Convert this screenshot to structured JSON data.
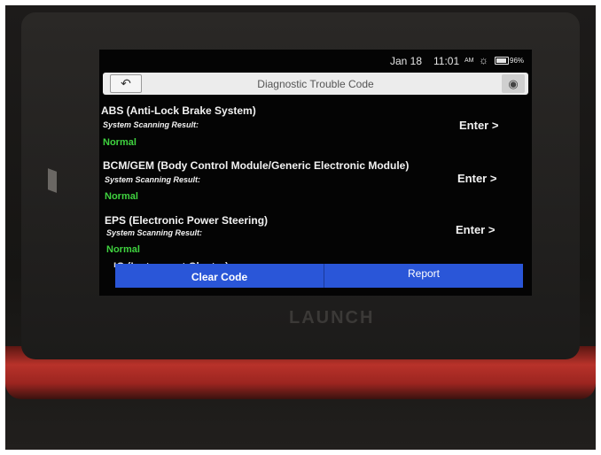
{
  "device": {
    "brand": "LAUNCH"
  },
  "status_bar": {
    "date": "Jan 18",
    "time": "11:01",
    "ampm": "AM",
    "battery": "96%"
  },
  "header": {
    "title": "Diagnostic Trouble Code",
    "back_icon": "back-arrow-icon",
    "camera_icon": "camera-icon"
  },
  "modules": [
    {
      "name": "ABS (Anti-Lock Brake System)",
      "result_label": "System Scanning Result:",
      "status": "Normal",
      "enter_label": "Enter >"
    },
    {
      "name": "BCM/GEM (Body Control Module/Generic Electronic Module)",
      "result_label": "System Scanning Result:",
      "status": "Normal",
      "enter_label": "Enter >"
    },
    {
      "name": "EPS (Electronic Power Steering)",
      "result_label": "System Scanning Result:",
      "status": "Normal",
      "enter_label": "Enter >"
    },
    {
      "name": "IC (Instrument Cluster)"
    }
  ],
  "actions": {
    "clear_code": "Clear Code",
    "report": "Report"
  },
  "colors": {
    "accent_blue": "#2a56d8",
    "normal_green": "#3fd23f",
    "device_red": "#b8322a"
  }
}
